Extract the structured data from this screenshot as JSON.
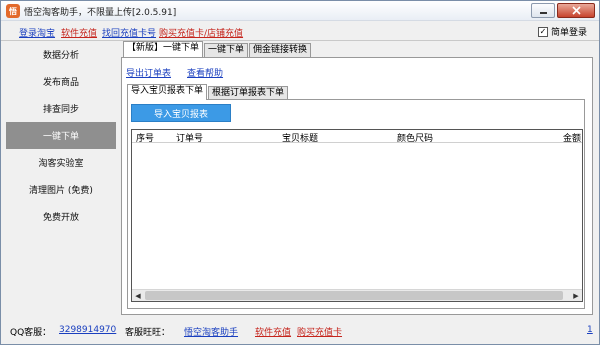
{
  "window": {
    "title": "悟空淘客助手，不限量上传[2.0.5.91]",
    "app_icon_glyph": "悟"
  },
  "toplinks": {
    "login_taobao": "登录淘宝",
    "software_recharge": "软件充值",
    "recover_card": "找回充值卡号",
    "buy_card": "购买充值卡/店铺充值",
    "simple_login": "简单登录"
  },
  "sidebar": {
    "items": [
      {
        "label": "数据分析"
      },
      {
        "label": "发布商品"
      },
      {
        "label": "排查同步"
      },
      {
        "label": "一键下单"
      },
      {
        "label": "淘客实验室"
      },
      {
        "label": "清理图片 (免费)"
      },
      {
        "label": "免费开放"
      }
    ],
    "active_index": 3
  },
  "main": {
    "tabs": [
      {
        "label": "【新版】一键下单"
      },
      {
        "label": "一键下单"
      },
      {
        "label": "佣金链接转换"
      }
    ],
    "export_link": "导出订单表",
    "help_link": "查看帮助",
    "subtabs": [
      {
        "label": "导入宝贝报表下单"
      },
      {
        "label": "根据订单报表下单"
      }
    ],
    "import_button": "导入宝贝报表",
    "grid_columns": [
      "序号",
      "订单号",
      "宝贝标题",
      "颜色尺码",
      "金额"
    ]
  },
  "statusbar": {
    "qq_label": "QQ客服：",
    "qq_number": "3298914970",
    "wangwang_label": "客服旺旺：",
    "wangwang_name": "悟空淘客助手",
    "software_recharge": "软件充值",
    "buy_card": "购买充值卡",
    "corner": "1"
  },
  "colors": {
    "link_blue": "#1a3fbf",
    "link_red": "#c5241c",
    "import_button": "#3c9ae6",
    "sidebar_active": "#8f8f8f"
  }
}
